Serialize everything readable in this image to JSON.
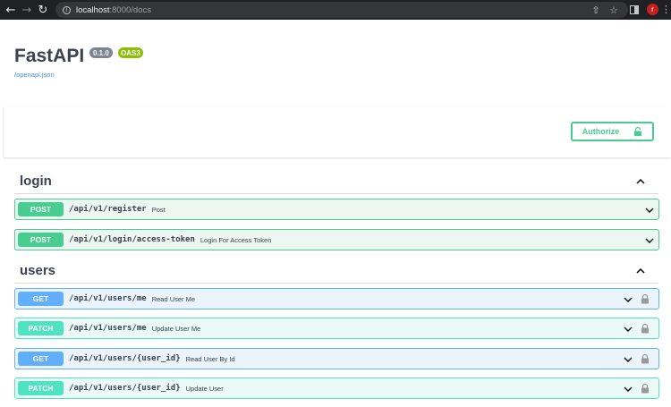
{
  "browser": {
    "url_host": "localhost",
    "url_rest": ":8000/docs",
    "avatar_letter": "r"
  },
  "info": {
    "title": "FastAPI",
    "version": "0.1.0",
    "oas": "OAS3",
    "openapi_link": "/openapi.json"
  },
  "auth": {
    "authorize_label": "Authorize"
  },
  "colors": {
    "post": "#49cc90",
    "get": "#61affe",
    "patch": "#50e3c2",
    "text": "#3b4151"
  },
  "sections": [
    {
      "name": "login",
      "operations": [
        {
          "method": "POST",
          "path": "/api/v1/register",
          "summary": "Post"
        },
        {
          "method": "POST",
          "path": "/api/v1/login/access-token",
          "summary": "Login For Access Token"
        }
      ]
    },
    {
      "name": "users",
      "operations": [
        {
          "method": "GET",
          "path": "/api/v1/users/me",
          "summary": "Read User Me"
        },
        {
          "method": "PATCH",
          "path": "/api/v1/users/me",
          "summary": "Update User Me"
        },
        {
          "method": "GET",
          "path": "/api/v1/users/{user_id}",
          "summary": "Read User By Id"
        },
        {
          "method": "PATCH",
          "path": "/api/v1/users/{user_id}",
          "summary": "Update User"
        }
      ]
    }
  ]
}
